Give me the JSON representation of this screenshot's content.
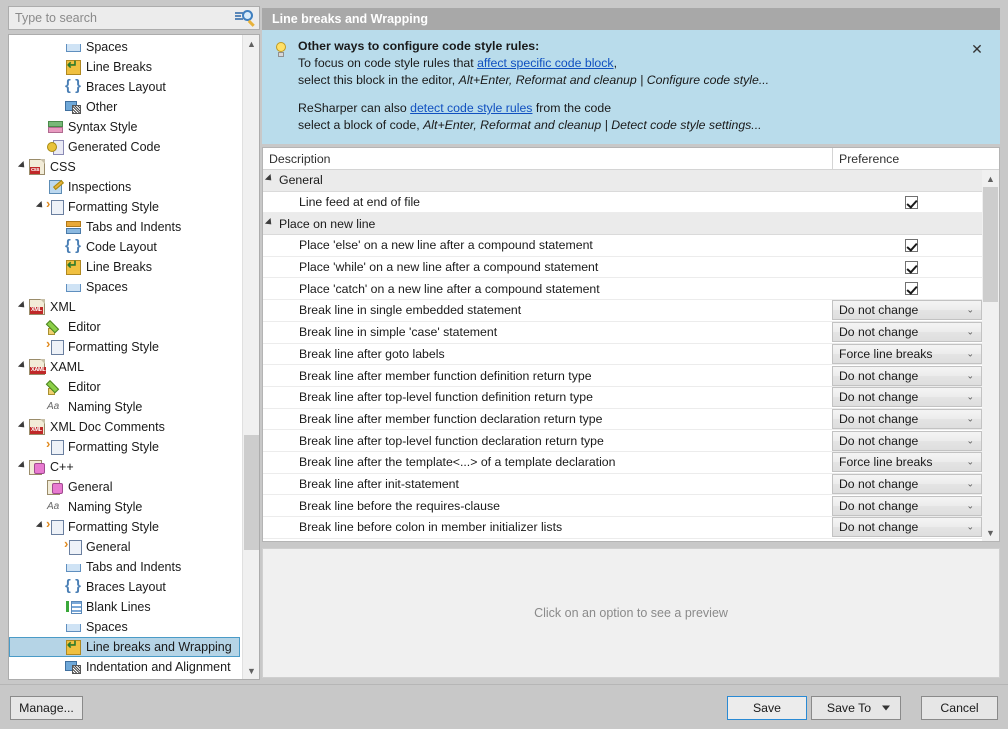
{
  "search": {
    "placeholder": "Type to search",
    "icon": "search-icon"
  },
  "tree": {
    "items": [
      {
        "label": "Spaces",
        "indent": 3,
        "icon": "spaces-icon",
        "twist": "",
        "selected": false
      },
      {
        "label": "Line Breaks",
        "indent": 3,
        "icon": "line-breaks-icon",
        "twist": "",
        "selected": false
      },
      {
        "label": "Braces Layout",
        "indent": 3,
        "icon": "braces-icon",
        "twist": "",
        "selected": false
      },
      {
        "label": "Other",
        "indent": 3,
        "icon": "other-icon",
        "twist": "",
        "selected": false
      },
      {
        "label": "Syntax Style",
        "indent": 2,
        "icon": "syntax-style-icon",
        "twist": "",
        "selected": false
      },
      {
        "label": "Generated Code",
        "indent": 2,
        "icon": "generated-code-icon",
        "twist": "",
        "selected": false
      },
      {
        "label": "CSS",
        "indent": 1,
        "icon": "css-doc-icon",
        "twist": "open",
        "selected": false
      },
      {
        "label": "Inspections",
        "indent": 2,
        "icon": "inspections-icon",
        "twist": "",
        "selected": false
      },
      {
        "label": "Formatting Style",
        "indent": 2,
        "icon": "formatting-icon",
        "twist": "open",
        "selected": false
      },
      {
        "label": "Tabs and Indents",
        "indent": 3,
        "icon": "tabs-indents-icon",
        "twist": "",
        "selected": false
      },
      {
        "label": "Code Layout",
        "indent": 3,
        "icon": "braces-icon",
        "twist": "",
        "selected": false
      },
      {
        "label": "Line Breaks",
        "indent": 3,
        "icon": "line-breaks-icon",
        "twist": "",
        "selected": false
      },
      {
        "label": "Spaces",
        "indent": 3,
        "icon": "spaces-icon",
        "twist": "",
        "selected": false
      },
      {
        "label": "XML",
        "indent": 1,
        "icon": "xml-doc-icon",
        "twist": "open",
        "selected": false
      },
      {
        "label": "Editor",
        "indent": 2,
        "icon": "editor-icon",
        "twist": "",
        "selected": false
      },
      {
        "label": "Formatting Style",
        "indent": 2,
        "icon": "formatting-icon",
        "twist": "",
        "selected": false
      },
      {
        "label": "XAML",
        "indent": 1,
        "icon": "xaml-doc-icon",
        "twist": "open",
        "selected": false
      },
      {
        "label": "Editor",
        "indent": 2,
        "icon": "editor-icon",
        "twist": "",
        "selected": false
      },
      {
        "label": "Naming Style",
        "indent": 2,
        "icon": "naming-style-icon",
        "twist": "",
        "selected": false
      },
      {
        "label": "XML Doc Comments",
        "indent": 1,
        "icon": "xmldoc-doc-icon",
        "twist": "open",
        "selected": false
      },
      {
        "label": "Formatting Style",
        "indent": 2,
        "icon": "formatting-icon",
        "twist": "",
        "selected": false
      },
      {
        "label": "C++",
        "indent": 1,
        "icon": "cpp-icon",
        "twist": "open",
        "selected": false
      },
      {
        "label": "General",
        "indent": 2,
        "icon": "cpp-icon",
        "twist": "",
        "selected": false
      },
      {
        "label": "Naming Style",
        "indent": 2,
        "icon": "naming-style-icon",
        "twist": "",
        "selected": false
      },
      {
        "label": "Formatting Style",
        "indent": 2,
        "icon": "formatting-icon",
        "twist": "open",
        "selected": false
      },
      {
        "label": "General",
        "indent": 3,
        "icon": "formatting-icon",
        "twist": "",
        "selected": false
      },
      {
        "label": "Tabs and Indents",
        "indent": 3,
        "icon": "spaces-icon",
        "twist": "",
        "selected": false
      },
      {
        "label": "Braces Layout",
        "indent": 3,
        "icon": "braces-icon",
        "twist": "",
        "selected": false
      },
      {
        "label": "Blank Lines",
        "indent": 3,
        "icon": "blank-lines-icon",
        "twist": "",
        "selected": false
      },
      {
        "label": "Spaces",
        "indent": 3,
        "icon": "spaces-icon",
        "twist": "",
        "selected": false
      },
      {
        "label": "Line breaks and Wrapping",
        "indent": 3,
        "icon": "line-breaks-icon",
        "twist": "",
        "selected": true
      },
      {
        "label": "Indentation and Alignment",
        "indent": 3,
        "icon": "other-icon",
        "twist": "",
        "selected": false
      }
    ]
  },
  "section": {
    "title": "Line breaks and Wrapping"
  },
  "banner": {
    "icon": "lightbulb-icon",
    "close_label": "✕",
    "heading": "Other ways to configure code style rules:",
    "line1_pre": "To focus on code style rules that ",
    "line1_link": "affect specific code block",
    "line1_post": ",",
    "line2_pre": "select this block in the editor, ",
    "line2_italic": "Alt+Enter, Reformat and cleanup | Configure code style...",
    "line3_pre": "ReSharper can also ",
    "line3_link": "detect code style rules",
    "line3_post": " from the code",
    "line4_pre": "select a block of code, ",
    "line4_italic": "Alt+Enter, Reformat and cleanup | Detect code style settings..."
  },
  "table": {
    "columns": {
      "description": "Description",
      "preference": "Preference"
    },
    "rows": [
      {
        "type": "group",
        "label": "General"
      },
      {
        "type": "checkbox",
        "label": "Line feed at end of file",
        "checked": true
      },
      {
        "type": "group",
        "label": "Place on new line"
      },
      {
        "type": "checkbox",
        "label": "Place 'else' on a new line after a compound statement",
        "checked": true
      },
      {
        "type": "checkbox",
        "label": "Place 'while' on a new line after a compound statement",
        "checked": true
      },
      {
        "type": "checkbox",
        "label": "Place 'catch' on a new line after a compound statement",
        "checked": true
      },
      {
        "type": "select",
        "label": "Break line in single embedded statement",
        "value": "Do not change"
      },
      {
        "type": "select",
        "label": "Break line in simple 'case' statement",
        "value": "Do not change"
      },
      {
        "type": "select",
        "label": "Break line after goto labels",
        "value": "Force line breaks"
      },
      {
        "type": "select",
        "label": "Break line after member function definition return type",
        "value": "Do not change"
      },
      {
        "type": "select",
        "label": "Break line after top-level function definition return type",
        "value": "Do not change"
      },
      {
        "type": "select",
        "label": "Break line after member function declaration return type",
        "value": "Do not change"
      },
      {
        "type": "select",
        "label": "Break line after top-level function declaration return type",
        "value": "Do not change"
      },
      {
        "type": "select",
        "label": "Break line after the template<...> of a template declaration",
        "value": "Force line breaks"
      },
      {
        "type": "select",
        "label": "Break line after init-statement",
        "value": "Do not change"
      },
      {
        "type": "select",
        "label": "Break line before the requires-clause",
        "value": "Do not change"
      },
      {
        "type": "select",
        "label": "Break line before colon in member initializer lists",
        "value": "Do not change"
      }
    ]
  },
  "preview": {
    "empty_text": "Click on an option to see a preview"
  },
  "footer": {
    "manage_label": "Manage...",
    "save_label": "Save",
    "save_to_label": "Save To",
    "cancel_label": "Cancel"
  },
  "colors": {
    "banner_bg": "#b9dceb",
    "title_bg": "#a8a8a8",
    "link": "#1050c0",
    "selection": "#b5d4e6",
    "selection_border": "#4a9bc7",
    "primary_border": "#2a8ad4"
  }
}
